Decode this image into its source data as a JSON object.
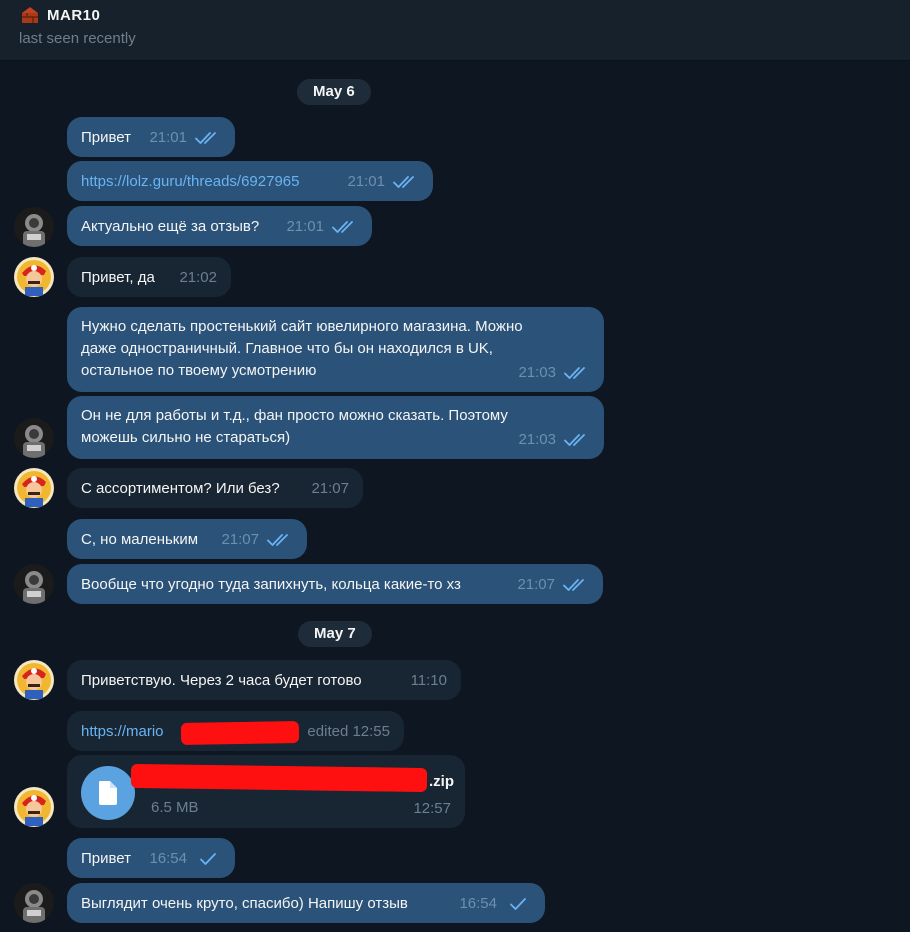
{
  "header": {
    "title": "MAR10",
    "status": "last seen recently"
  },
  "dates": [
    "May 6",
    "May 7"
  ],
  "messages": [
    {
      "text": "Привет",
      "time": "21:01"
    },
    {
      "text": "https://lolz.guru/threads/6927965",
      "time": "21:01"
    },
    {
      "text": "Актуально ещё за отзыв?",
      "time": "21:01"
    },
    {
      "text": "Привет, да",
      "time": "21:02"
    },
    {
      "text": "Нужно сделать простенький сайт ювелирного магазина. Можно\nдаже одностраничный. Главное что бы он находился в UK,\nостальное по твоему усмотрению",
      "time": "21:03"
    },
    {
      "text": "Он не для работы и т.д., фан просто можно сказать. Поэтому\nможешь сильно не стараться)",
      "time": "21:03"
    },
    {
      "text": "С ассортиментом? Или без?",
      "time": "21:07"
    },
    {
      "text": "С, но маленьким",
      "time": "21:07"
    },
    {
      "text": "Вообще что угодно туда запихнуть, кольца какие-то хз",
      "time": "21:07"
    },
    {
      "text": "Приветствую. Через 2 часа будет готово",
      "time": "11:10"
    },
    {
      "text": "https://mario",
      "time": "edited 12:55"
    },
    {
      "file_ext": ".zip",
      "size": "6.5 MB",
      "time": "12:57"
    },
    {
      "text": "Привет",
      "time": "16:54"
    },
    {
      "text": "Выглядит очень круто, спасибо) Напишу отзыв",
      "time": "16:54"
    }
  ],
  "colors": {
    "background": "#0e1621",
    "outgoing_bubble": "#2b5278",
    "incoming_bubble": "#182533",
    "link": "#6ab3f3",
    "check": "#6ab3f3"
  }
}
